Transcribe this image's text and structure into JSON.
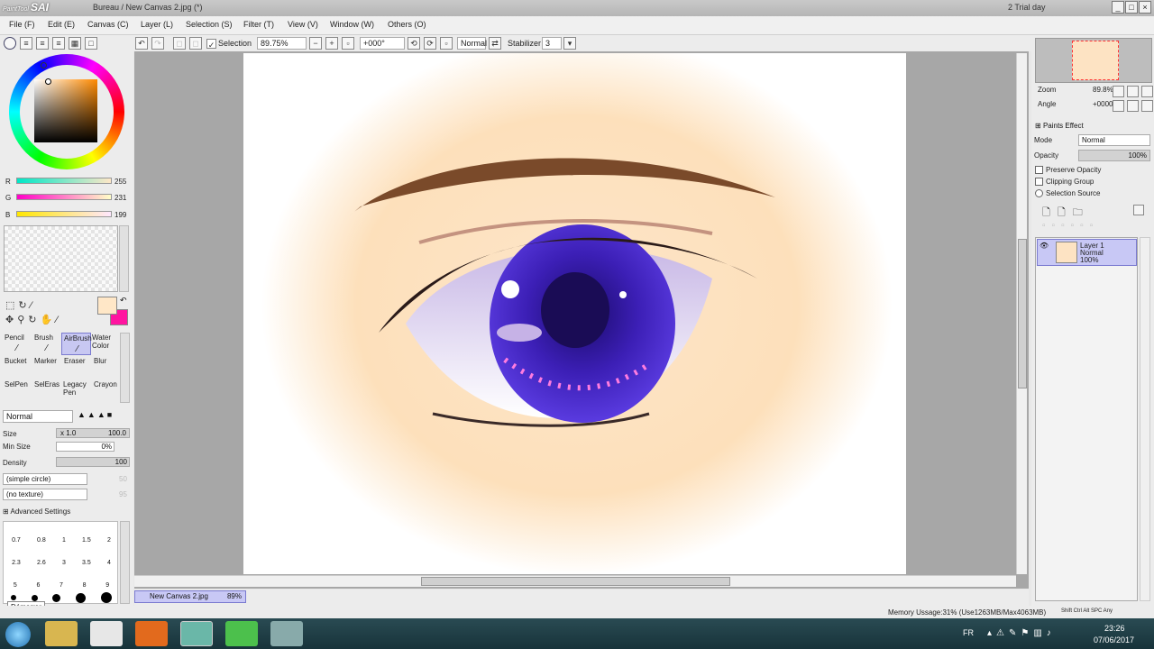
{
  "title_bar": {
    "logo_text": "SAI",
    "logo_small": "PaintTool",
    "window_title": "Bureau / New Canvas 2.jpg (*)",
    "trial": "2 Trial day",
    "minimize": "_",
    "maximize": "□",
    "close": "×"
  },
  "menu": {
    "items": [
      "File (F)",
      "Edit (E)",
      "Canvas (C)",
      "Layer (L)",
      "Selection (S)",
      "Filter (T)",
      "View (V)",
      "Window (W)",
      "Others (O)"
    ]
  },
  "toolbar": {
    "selection_label": "Selection",
    "zoom": "89.75%",
    "angle": "+000°",
    "blend": "Normal",
    "stabilizer_label": "Stabilizer",
    "stabilizer_value": "3"
  },
  "color": {
    "r_label": "R",
    "r_value": "255",
    "g_label": "G",
    "g_value": "231",
    "b_label": "B",
    "b_value": "199",
    "primary": "#ffe7c7",
    "secondary": "#ff14a0"
  },
  "tools": {
    "items": [
      "Pencil",
      "Brush",
      "AirBrush",
      "Water Color",
      "Bucket",
      "Marker",
      "Eraser",
      "Blur",
      "SelPen",
      "SelEras",
      "Legacy Pen",
      "Crayon"
    ]
  },
  "brush": {
    "mode": "Normal",
    "size_label": "Size",
    "size_mult": "x 1.0",
    "size_value": "100.0",
    "min_size_label": "Min Size",
    "min_size_value": "0%",
    "density_label": "Density",
    "density_value": "100",
    "shape": "(simple circle)",
    "shape_value": "50",
    "texture": "(no texture)",
    "texture_value": "95",
    "advanced": "Advanced Settings"
  },
  "brush_sizes": {
    "row1": [
      "0.7",
      "0.8",
      "1",
      "1.5",
      "2"
    ],
    "row2": [
      "2.3",
      "2.6",
      "3",
      "3.5",
      "4"
    ],
    "row3": [
      "5",
      "6",
      "7",
      "8",
      "9"
    ]
  },
  "navigator": {
    "zoom_label": "Zoom",
    "zoom_value": "89.8%",
    "angle_label": "Angle",
    "angle_value": "+0000"
  },
  "layer_props": {
    "paints_effect": "Paints Effect",
    "mode_label": "Mode",
    "mode_value": "Normal",
    "opacity_label": "Opacity",
    "opacity_value": "100%",
    "preserve_opacity": "Preserve Opacity",
    "clipping_group": "Clipping Group",
    "selection_source": "Selection Source"
  },
  "layers": [
    {
      "name": "Layer 1",
      "mode": "Normal",
      "opacity": "100%"
    }
  ],
  "document_tab": {
    "name": "New Canvas 2.jpg",
    "zoom": "89%"
  },
  "tooltip": "Démarrer",
  "status": {
    "memory": "Memory Ussage:31% (Use1263MB/Max4063MB)",
    "keys": "Shift Ctrl Alt SPC Any"
  },
  "taskbar": {
    "lang": "FR",
    "time": "23:26",
    "date": "07/06/2017"
  }
}
